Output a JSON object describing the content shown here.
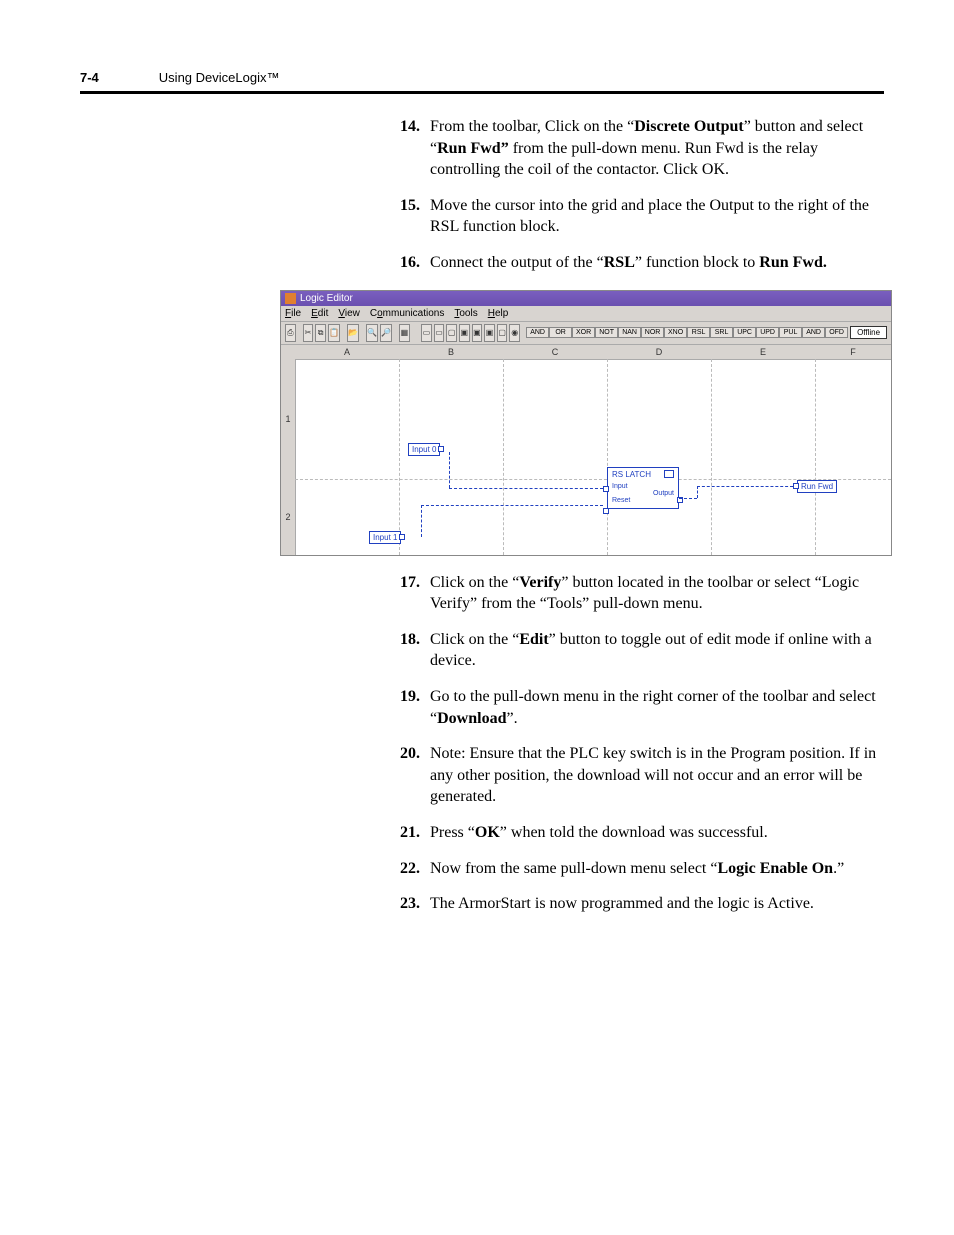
{
  "header": {
    "page_num": "7-4",
    "title": "Using DeviceLogix™"
  },
  "steps_a": [
    {
      "n": "14.",
      "pre": "From the toolbar, Click on the “",
      "b1": "Discrete Output",
      "mid1": "” button and select “",
      "b2": "Run Fwd”",
      "post": " from the pull-down menu. Run Fwd is the relay controlling the coil of the contactor. Click OK."
    },
    {
      "n": "15.",
      "text": "Move the cursor into the grid and place the Output to the right of the RSL function block."
    },
    {
      "n": "16.",
      "pre": "Connect the output of the “",
      "b1": "RSL",
      "mid1": "” function block to ",
      "b2": "Run Fwd.",
      "post": ""
    }
  ],
  "steps_b": [
    {
      "n": "17.",
      "pre": "Click on the “",
      "b1": "Verify",
      "post": "” button located in the toolbar or select “Logic Verify” from the “Tools” pull-down menu."
    },
    {
      "n": "18.",
      "pre": "Click on the “",
      "b1": "Edit",
      "post": "” button to toggle out of edit mode if online with a device."
    },
    {
      "n": "19.",
      "pre": "Go to the pull-down menu in the right corner of the toolbar and select “",
      "b1": "Download",
      "post": "”."
    },
    {
      "n": "20.",
      "text": "Note: Ensure that the PLC key switch is in the Program position. If in any other position, the download will not occur and an error will be generated."
    },
    {
      "n": "21.",
      "pre": "Press “",
      "b1": "OK",
      "post": "” when told the download was successful."
    },
    {
      "n": "22.",
      "pre": "Now from the same pull-down menu select “",
      "b1": "Logic Enable On",
      "post": ".”"
    },
    {
      "n": "23.",
      "text": "The ArmorStart is now programmed and the logic is Active."
    }
  ],
  "figure": {
    "title": "Logic Editor",
    "menu": {
      "file": "File",
      "edit": "Edit",
      "view": "View",
      "comm": "Communications",
      "tools": "Tools",
      "help": "Help"
    },
    "logic_buttons": [
      "AND",
      "OR",
      "XOR",
      "NOT",
      "NAN",
      "NOR",
      "XNO",
      "RSL",
      "SRL",
      "UPC",
      "UPD",
      "PUL",
      "AND",
      "OFD"
    ],
    "status": "Offline",
    "columns": [
      "A",
      "B",
      "C",
      "D",
      "E",
      "F"
    ],
    "rows": [
      "1",
      "2"
    ],
    "input0": "Input 0",
    "input1": "Input 1",
    "block": {
      "title": "RS LATCH",
      "in1": "Input",
      "in2": "Reset",
      "out": "Output"
    },
    "output": "Run Fwd"
  }
}
